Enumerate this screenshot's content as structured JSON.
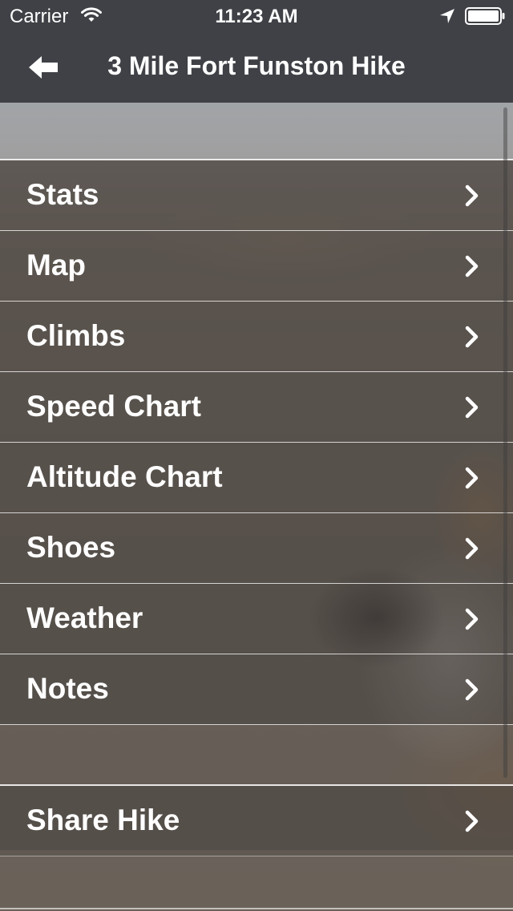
{
  "status_bar": {
    "carrier": "Carrier",
    "time": "11:23 AM",
    "icons": [
      "wifi-icon",
      "location-icon",
      "battery-icon"
    ]
  },
  "nav": {
    "title": "3 Mile Fort Funston Hike",
    "back_icon": "back-arrow-icon"
  },
  "menu": {
    "items": [
      {
        "label": "Stats"
      },
      {
        "label": "Map"
      },
      {
        "label": "Climbs"
      },
      {
        "label": "Speed Chart"
      },
      {
        "label": "Altitude Chart"
      },
      {
        "label": "Shoes"
      },
      {
        "label": "Weather"
      },
      {
        "label": "Notes"
      }
    ],
    "share": {
      "label": "Share Hike"
    }
  },
  "colors": {
    "bar_background": "#3f4146",
    "text": "#ffffff"
  }
}
